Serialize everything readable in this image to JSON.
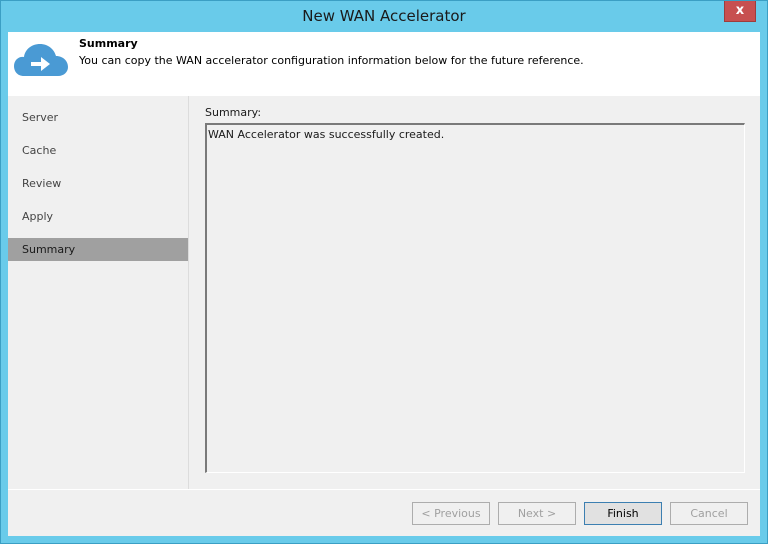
{
  "window": {
    "title": "New WAN Accelerator",
    "close_label": "x"
  },
  "header": {
    "icon": "cloud-arrow-icon",
    "title": "Summary",
    "description": "You can copy the WAN accelerator configuration information below for the future reference."
  },
  "sidebar": {
    "items": [
      {
        "label": "Server",
        "active": false
      },
      {
        "label": "Cache",
        "active": false
      },
      {
        "label": "Review",
        "active": false
      },
      {
        "label": "Apply",
        "active": false
      },
      {
        "label": "Summary",
        "active": true
      }
    ]
  },
  "main": {
    "summary_label": "Summary:",
    "summary_text": "WAN Accelerator was successfully created."
  },
  "footer": {
    "previous_label": "< Previous",
    "next_label": "Next >",
    "finish_label": "Finish",
    "cancel_label": "Cancel"
  },
  "colors": {
    "titlebar": "#69cbea",
    "close": "#c75050",
    "active_nav": "#a0a0a0",
    "icon_blue": "#4a9ad4"
  }
}
